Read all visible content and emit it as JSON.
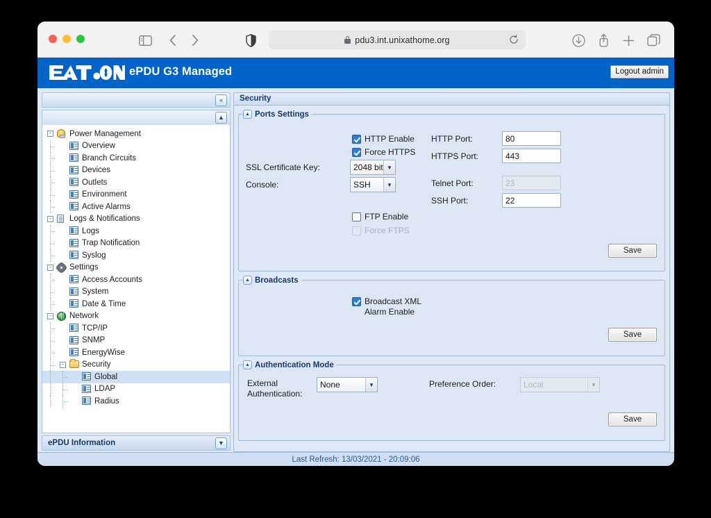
{
  "browser": {
    "url": "pdu3.int.unixathome.org",
    "icons": {
      "sidebar": "sidebar-toggle-icon",
      "back": "back-icon",
      "forward": "forward-icon",
      "shield": "shield-icon",
      "lock": "lock-icon",
      "reload": "reload-icon",
      "download": "download-icon",
      "share": "share-icon",
      "newtab": "new-tab-icon",
      "tabs": "tabs-icon"
    }
  },
  "header": {
    "logo_text": "EATON",
    "title": "ePDU G3 Managed",
    "logout_label": "Logout admin",
    "brand_color": "#0063c8"
  },
  "sidebar": {
    "collapse_label": "«",
    "tree_collapse_label": "▲",
    "info_label": "ePDU Information",
    "info_expand_label": "▼",
    "tree": [
      {
        "label": "Power Management",
        "level": 0,
        "icon": "bulb-icon",
        "expander": "-"
      },
      {
        "label": "Overview",
        "level": 1,
        "icon": "page-icon"
      },
      {
        "label": "Branch Circuits",
        "level": 1,
        "icon": "page-icon"
      },
      {
        "label": "Devices",
        "level": 1,
        "icon": "page-icon"
      },
      {
        "label": "Outlets",
        "level": 1,
        "icon": "page-icon"
      },
      {
        "label": "Environment",
        "level": 1,
        "icon": "page-icon"
      },
      {
        "label": "Active Alarms",
        "level": 1,
        "icon": "page-icon"
      },
      {
        "label": "Logs & Notifications",
        "level": 0,
        "icon": "logs-icon",
        "expander": "-"
      },
      {
        "label": "Logs",
        "level": 1,
        "icon": "page-icon"
      },
      {
        "label": "Trap Notification",
        "level": 1,
        "icon": "page-icon"
      },
      {
        "label": "Syslog",
        "level": 1,
        "icon": "page-icon"
      },
      {
        "label": "Settings",
        "level": 0,
        "icon": "gear-icon",
        "expander": "-"
      },
      {
        "label": "Access Accounts",
        "level": 1,
        "icon": "page-icon"
      },
      {
        "label": "System",
        "level": 1,
        "icon": "page-icon"
      },
      {
        "label": "Date & Time",
        "level": 1,
        "icon": "page-icon"
      },
      {
        "label": "Network",
        "level": 0,
        "icon": "globe-icon",
        "expander": "-"
      },
      {
        "label": "TCP/IP",
        "level": 1,
        "icon": "page-icon"
      },
      {
        "label": "SNMP",
        "level": 1,
        "icon": "page-icon"
      },
      {
        "label": "EnergyWise",
        "level": 1,
        "icon": "page-icon"
      },
      {
        "label": "Security",
        "level": 1,
        "icon": "folder-icon",
        "expander": "-"
      },
      {
        "label": "Global",
        "level": 2,
        "icon": "page-icon",
        "selected": true
      },
      {
        "label": "LDAP",
        "level": 2,
        "icon": "page-icon"
      },
      {
        "label": "Radius",
        "level": 2,
        "icon": "page-icon"
      }
    ]
  },
  "content": {
    "title": "Security",
    "ports_settings": {
      "legend": "Ports Settings",
      "toggle": "▲",
      "http_enable_label": "HTTP Enable",
      "http_enable_checked": true,
      "force_https_label": "Force HTTPS",
      "force_https_checked": true,
      "ssl_key_label": "SSL Certificate Key:",
      "ssl_key_value": "2048 bit",
      "console_label": "Console:",
      "console_value": "SSH",
      "ftp_enable_label": "FTP Enable",
      "ftp_enable_checked": false,
      "force_ftps_label": "Force FTPS",
      "force_ftps_checked": false,
      "http_port_label": "HTTP Port:",
      "http_port_value": "80",
      "https_port_label": "HTTPS Port:",
      "https_port_value": "443",
      "telnet_port_label": "Telnet Port:",
      "telnet_port_value": "23",
      "ssh_port_label": "SSH Port:",
      "ssh_port_value": "22",
      "save_label": "Save"
    },
    "broadcasts": {
      "legend": "Broadcasts",
      "toggle": "▲",
      "broadcast_xml_label_line1": "Broadcast XML",
      "broadcast_xml_label_line2": "Alarm Enable",
      "broadcast_xml_checked": true,
      "save_label": "Save"
    },
    "authentication_mode": {
      "legend": "Authentication Mode",
      "toggle": "▲",
      "external_auth_label_line1": "External",
      "external_auth_label_line2": "Authentication:",
      "external_auth_value": "None",
      "preference_order_label": "Preference Order:",
      "preference_order_value": "Local",
      "save_label": "Save"
    }
  },
  "status": {
    "last_refresh": "Last Refresh: 13/03/2021 - 20:09:06"
  }
}
